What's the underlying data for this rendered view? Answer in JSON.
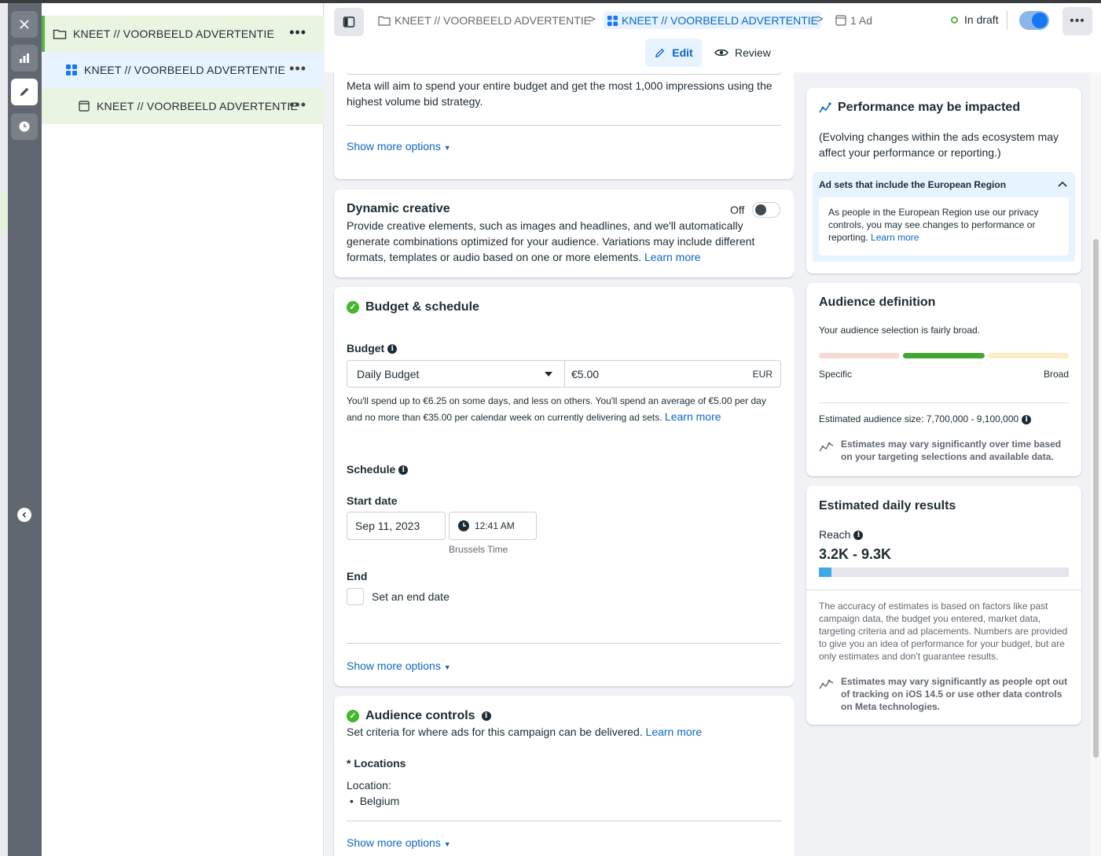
{
  "tree": {
    "campaign": "KNEET // VOORBEELD ADVERTENTIE",
    "adset": "KNEET // VOORBEELD ADVERTENTIE",
    "ad": "KNEET // VOORBEELD ADVERTENTIE"
  },
  "header": {
    "breadcrumbs": [
      "KNEET // VOORBEELD ADVERTENTIE",
      "KNEET // VOORBEELD ADVERTENTIE",
      "1 Ad"
    ],
    "status": "In draft",
    "tab_edit": "Edit",
    "tab_review": "Review"
  },
  "bid": {
    "text": "Meta will aim to spend your entire budget and get the most 1,000 impressions using the highest volume bid strategy.",
    "show_more": "Show more options"
  },
  "dynamic": {
    "title": "Dynamic creative",
    "toggle_label": "Off",
    "text": "Provide creative elements, such as images and headlines, and we'll automatically generate combinations optimized for your audience. Variations may include different formats, templates or audio based on one or more elements.",
    "learn_more": "Learn more"
  },
  "budget": {
    "title": "Budget & schedule",
    "budget_label": "Budget",
    "budget_type": "Daily Budget",
    "amount": "€5.00",
    "currency": "EUR",
    "note": "You'll spend up to €6.25 on some days, and less on others. You'll spend an average of €5.00 per day and no more than €35.00 per calendar week on currently delivering ad sets.",
    "learn_more": "Learn more",
    "schedule_label": "Schedule",
    "start_label": "Start date",
    "start_date": "Sep 11, 2023",
    "start_time": "12:41 AM",
    "timezone": "Brussels Time",
    "end_label": "End",
    "end_checkbox": "Set an end date",
    "show_more": "Show more options"
  },
  "audience_controls": {
    "title": "Audience controls",
    "text": "Set criteria for where ads for this campaign can be delivered.",
    "learn_more": "Learn more",
    "locations_label": "Locations",
    "required_mark": "*",
    "location_prefix": "Location:",
    "locations": [
      "Belgium"
    ],
    "show_more": "Show more options"
  },
  "performance": {
    "title": "Performance may be impacted",
    "text": "(Evolving changes within the ads ecosystem may affect your performance or reporting.)",
    "region_title": "Ad sets that include the European Region",
    "region_text": "As people in the European Region use our privacy controls, you may see changes to performance or reporting.",
    "learn_more": "Learn more"
  },
  "audience_definition": {
    "title": "Audience definition",
    "text": "Your audience selection is fairly broad.",
    "specific": "Specific",
    "broad": "Broad",
    "size_label": "Estimated audience size: 7,700,000 - 9,100,000",
    "estimate_note": "Estimates may vary significantly over time based on your targeting selections and available data."
  },
  "daily_results": {
    "title": "Estimated daily results",
    "reach_label": "Reach",
    "reach_value": "3.2K - 9.3K",
    "reach_fill_fraction": 0.05,
    "accuracy_text": "The accuracy of estimates is based on factors like past campaign data, the budget you entered, market data, targeting criteria and ad placements. Numbers are provided to give you an idea of performance for your budget, but are only estimates and don't guarantee results.",
    "ios_note": "Estimates may vary significantly as people opt out of tracking on iOS 14.5 or use other data controls on Meta technologies."
  },
  "colors": {
    "accent": "#0a66c2",
    "success": "#42b72a",
    "meter_green": "#42a531",
    "meter_specific": "#f6d9d5",
    "meter_broad": "#fbecc7"
  }
}
